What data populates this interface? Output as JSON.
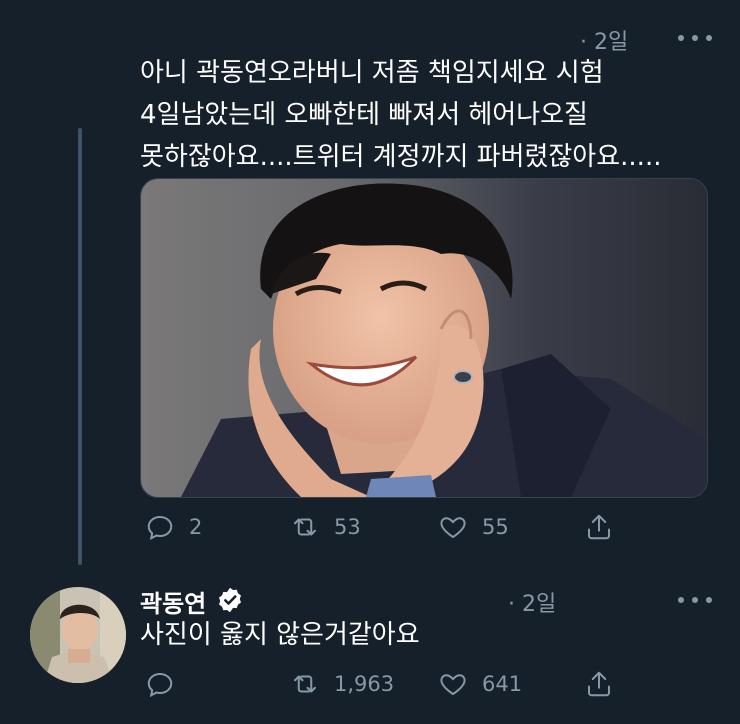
{
  "tweet": {
    "time": "· 2일",
    "text": "아니 곽동연오라버니 저좀 책임지세요 시험 4일남았는데 오빠한테 빠져서 헤어나오질 못하잖아요....트위터 계정까지 파버렸잖아요.....",
    "stats": {
      "replies": "2",
      "retweets": "53",
      "likes": "55"
    }
  },
  "reply": {
    "author": "곽동연",
    "time": "· 2일",
    "text": "사진이 옳지 않은거같아요",
    "stats": {
      "replies": "",
      "retweets": "1,963",
      "likes": "641"
    }
  },
  "icons": {
    "reply": "reply-icon",
    "retweet": "retweet-icon",
    "like": "heart-icon",
    "share": "share-icon",
    "more": "more-icon",
    "verified": "verified-icon"
  },
  "colors": {
    "background": "#15202b",
    "secondary_text": "#8899a6",
    "thread_line": "#3d5466"
  }
}
